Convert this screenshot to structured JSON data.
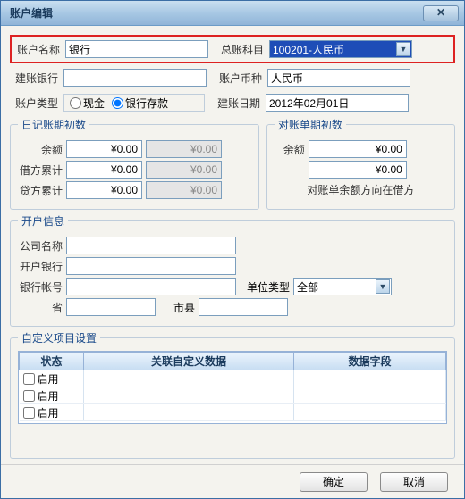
{
  "window": {
    "title": "账户编辑"
  },
  "topRow": {
    "accountNameLabel": "账户名称",
    "accountName": "银行",
    "ledgerLabel": "总账科目",
    "ledgerValue": "100201-人民币"
  },
  "row2": {
    "bankLabel": "建账银行",
    "bankValue": "",
    "currencyLabel": "账户币种",
    "currencyValue": "人民币"
  },
  "row3": {
    "typeLabel": "账户类型",
    "cash": "现金",
    "deposit": "银行存款",
    "dateLabel": "建账日期",
    "dateValue": "2012年02月01日"
  },
  "journal": {
    "legend": "日记账期初数",
    "balanceLabel": "余额",
    "balance1": "¥0.00",
    "balance2": "¥0.00",
    "debitLabel": "借方累计",
    "debit1": "¥0.00",
    "debit2": "¥0.00",
    "creditLabel": "贷方累计",
    "credit1": "¥0.00",
    "credit2": "¥0.00"
  },
  "statement": {
    "legend": "对账单期初数",
    "balanceLabel": "余额",
    "balance1": "¥0.00",
    "balance2": "¥0.00",
    "note": "对账单余额方向在借方"
  },
  "openInfo": {
    "legend": "开户信息",
    "companyLabel": "公司名称",
    "bankLabel": "开户银行",
    "acctLabel": "银行帐号",
    "provinceLabel": "省",
    "cityLabel": "市县",
    "unitTypeLabel": "单位类型",
    "unitTypeValue": "全部"
  },
  "custom": {
    "legend": "自定义项目设置",
    "colStatus": "状态",
    "colLink": "关联自定义数据",
    "colField": "数据字段",
    "enable": "启用"
  },
  "buttons": {
    "ok": "确定",
    "cancel": "取消"
  }
}
